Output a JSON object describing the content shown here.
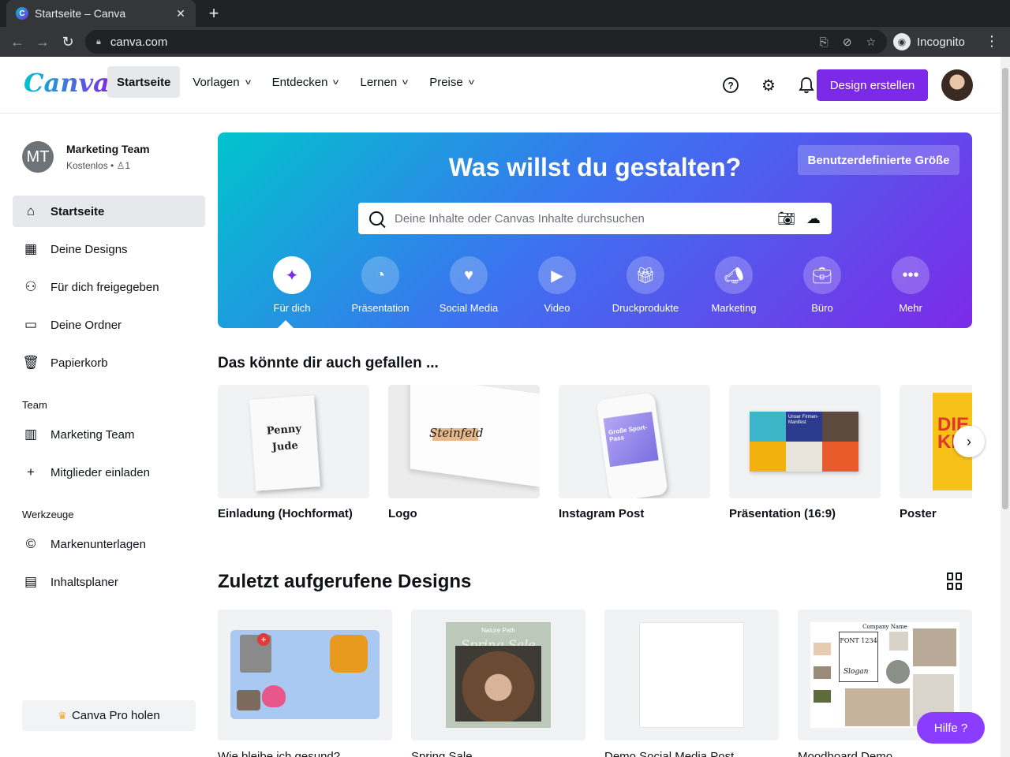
{
  "browser": {
    "tab_title": "Startseite – Canva",
    "url": "canva.com",
    "mode_label": "Incognito"
  },
  "header": {
    "logo_text": "Canva",
    "nav": [
      {
        "label": "Startseite",
        "active": true
      },
      {
        "label": "Vorlagen",
        "dropdown": true
      },
      {
        "label": "Entdecken",
        "dropdown": true
      },
      {
        "label": "Lernen",
        "dropdown": true
      },
      {
        "label": "Preise",
        "dropdown": true
      }
    ],
    "create_button": "Design erstellen"
  },
  "sidebar": {
    "team": {
      "initials": "MT",
      "name": "Marketing Team",
      "plan": "Kostenlos",
      "members": "1"
    },
    "items": [
      {
        "label": "Startseite",
        "icon": "home-icon",
        "active": true
      },
      {
        "label": "Deine Designs",
        "icon": "grid-icon"
      },
      {
        "label": "Für dich freigegeben",
        "icon": "people-icon"
      },
      {
        "label": "Deine Ordner",
        "icon": "folder-icon"
      },
      {
        "label": "Papierkorb",
        "icon": "trash-icon"
      }
    ],
    "team_heading": "Team",
    "team_items": [
      {
        "label": "Marketing Team",
        "icon": "building-icon"
      },
      {
        "label": "Mitglieder einladen",
        "icon": "plus-icon"
      }
    ],
    "tools_heading": "Werkzeuge",
    "tools_items": [
      {
        "label": "Markenunterlagen",
        "icon": "brand-kit-icon"
      },
      {
        "label": "Inhaltsplaner",
        "icon": "calendar-icon"
      }
    ],
    "pro_button": "Canva Pro holen"
  },
  "hero": {
    "title": "Was willst du gestalten?",
    "custom_size": "Benutzerdefinierte Größe",
    "search_placeholder": "Deine Inhalte oder Canvas Inhalte durchsuchen",
    "categories": [
      {
        "label": "Für dich",
        "icon": "sparkle-icon",
        "active": true
      },
      {
        "label": "Präsentation",
        "icon": "presentation-icon"
      },
      {
        "label": "Social Media",
        "icon": "heart-chat-icon"
      },
      {
        "label": "Video",
        "icon": "video-camera-icon"
      },
      {
        "label": "Druckprodukte",
        "icon": "gift-icon"
      },
      {
        "label": "Marketing",
        "icon": "megaphone-icon"
      },
      {
        "label": "Büro",
        "icon": "briefcase-icon"
      },
      {
        "label": "Mehr",
        "icon": "more-icon"
      }
    ]
  },
  "suggestions": {
    "title": "Das könnte dir auch gefallen ...",
    "items": [
      {
        "label": "Einladung (Hochformat)"
      },
      {
        "label": "Logo"
      },
      {
        "label": "Instagram Post"
      },
      {
        "label": "Präsentation (16:9)"
      },
      {
        "label": "Poster"
      }
    ],
    "thumb_text": {
      "invite_1": "Penny",
      "invite_2": "Jude",
      "logo": "Steinfeld",
      "insta": "Große Sport-Pass",
      "pres": "Unser Firmen-Manifest",
      "poster": "DIE JU KI"
    }
  },
  "recent": {
    "title": "Zuletzt aufgerufene Designs",
    "items": [
      {
        "label": "Wie bleibe ich gesund?"
      },
      {
        "label": "Spring Sale"
      },
      {
        "label": "Demo Social Media Post"
      },
      {
        "label": "Moodboard Demo"
      }
    ],
    "thumb_text": {
      "spring_top": "Nature Path",
      "spring_mid": "Spring Sale",
      "mood_company": "Company Name",
      "mood_font": "FONT 1234",
      "mood_slogan": "Slogan"
    }
  },
  "help_button": "Hilfe  ?"
}
